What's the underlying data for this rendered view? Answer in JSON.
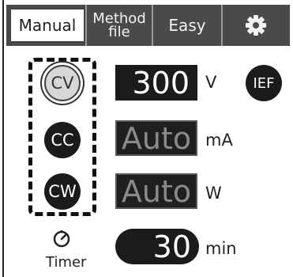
{
  "tabs": {
    "manual": "Manual",
    "method_line1": "Method",
    "method_line2": "file",
    "easy": "Easy",
    "settings_icon": "gear-icon"
  },
  "modes": {
    "cv": "CV",
    "cc": "CC",
    "cw": "CW",
    "selected": "CV"
  },
  "voltage": {
    "value": "300",
    "unit": "V"
  },
  "current": {
    "value": "Auto",
    "unit": "mA"
  },
  "power": {
    "value": "Auto",
    "unit": "W"
  },
  "timer": {
    "value": "30",
    "unit": "min",
    "label": "Timer",
    "icon": "stopwatch-icon"
  },
  "ief_button": "IEF",
  "colors": {
    "panel_dark": "#1b1b1b",
    "tabbar": "#4a4a4a",
    "selected_mode": "#d7d7d7",
    "dim_text": "#8a8a8a"
  }
}
